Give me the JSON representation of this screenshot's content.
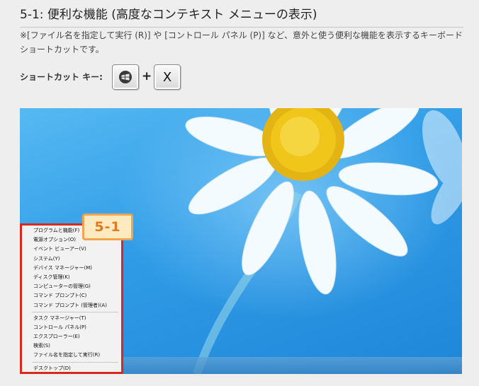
{
  "heading": "5-1: 便利な機能 (高度なコンテキスト メニューの表示)",
  "description": "※[ファイル名を指定して実行 (R)] や [コントロール パネル (P)] など、意外と使う便利な機能を表示するキーボード ショートカットです。",
  "shortcut": {
    "label": "ショートカット キー:",
    "plus": "+",
    "key2": "X",
    "key1_icon": "windows-logo-icon"
  },
  "callout": "5-1",
  "menu": {
    "group1": [
      "プログラムと機能(F)",
      "電源オプション(O)",
      "イベント ビューアー(V)",
      "システム(Y)",
      "デバイス マネージャー(M)",
      "ディスク管理(K)",
      "コンピューターの管理(G)",
      "コマンド プロンプト(C)",
      "コマンド プロンプト (管理者)(A)"
    ],
    "group2": [
      "タスク マネージャー(T)",
      "コントロール パネル(P)",
      "エクスプローラー(E)",
      "検索(S)",
      "ファイル名を指定して実行(R)"
    ],
    "group3": [
      "デスクトップ(D)"
    ]
  },
  "colors": {
    "highlight_border": "#d8281f",
    "callout_border": "#f3a44d",
    "callout_text": "#e07a1c"
  }
}
